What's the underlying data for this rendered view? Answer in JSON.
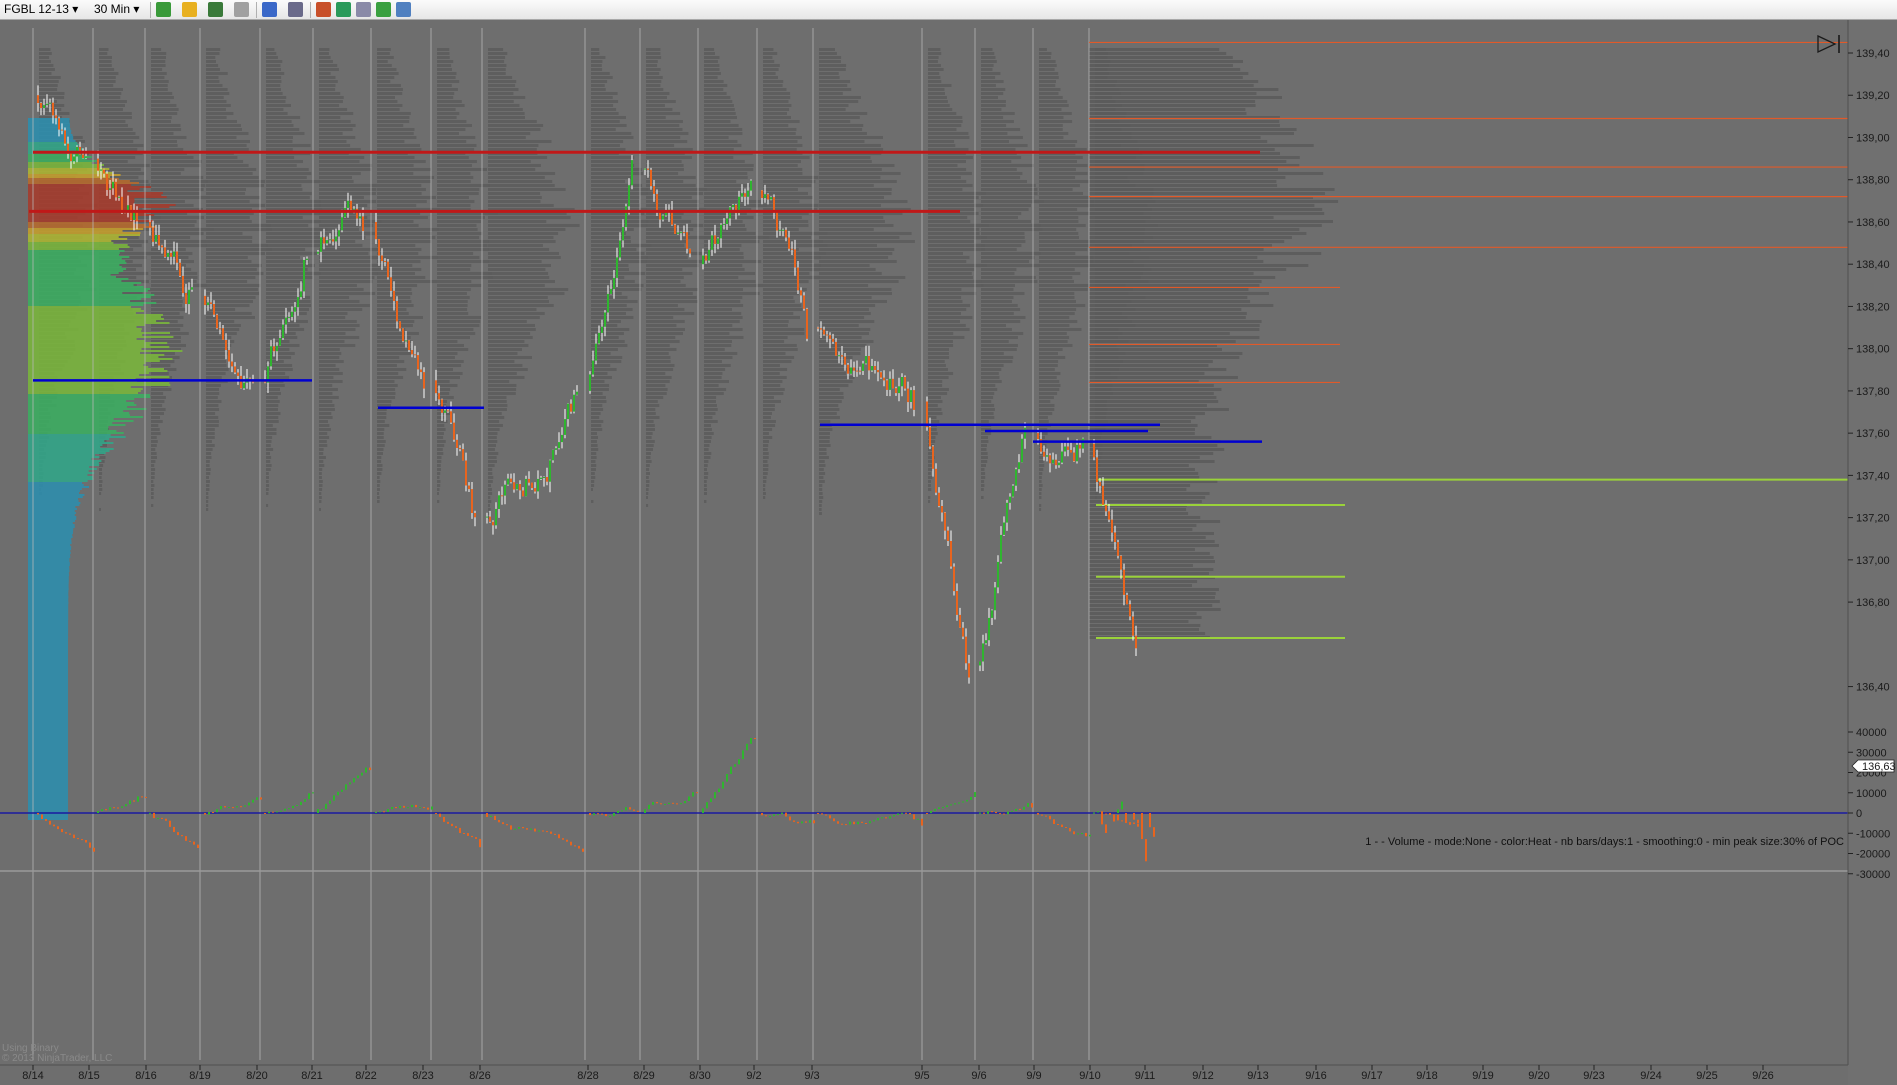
{
  "toolbar": {
    "instrument": "FGBL 12-13",
    "interval": "30 Min",
    "icons": [
      "bar-type-icon",
      "pencil-draw-icon",
      "properties-icon",
      "line-tool-icon",
      "crosshair-icon",
      "zoom-icon",
      "data-box-icon",
      "indicators-icon",
      "strategy-icon",
      "chart-trader-icon",
      "image-icon",
      "dollar-icon",
      "layout-icon"
    ]
  },
  "colors": {
    "background": "#6e6e6e",
    "up_candle": "#2fb52f",
    "down_candle": "#e8641e",
    "wick": "#ffffff",
    "value_area_low": "#0000d0",
    "value_area_high": "#c01818",
    "support_level": "#9ad23a",
    "resistance_level": "#e05a2a",
    "zero_line": "#1a1aa0"
  },
  "chart_data": [
    {
      "type": "candlestick",
      "title": "",
      "panel": "price",
      "ylim": [
        136.3,
        139.5
      ],
      "y_ticks": [
        "139,40",
        "139,20",
        "139,00",
        "138,80",
        "138,60",
        "138,40",
        "138,20",
        "138,00",
        "137,80",
        "137,60",
        "137,40",
        "137,20",
        "137,00",
        "136,80",
        "136,63",
        "136,40"
      ],
      "last_price": "136,63",
      "dates": [
        "8/14",
        "8/15",
        "8/16",
        "8/19",
        "8/20",
        "8/21",
        "8/22",
        "8/23",
        "8/26",
        "8/28",
        "8/29",
        "8/30",
        "9/2",
        "9/3",
        "9/5",
        "9/6",
        "9/9",
        "9/10",
        "9/11",
        "9/12",
        "9/13",
        "9/16",
        "9/17",
        "9/18",
        "9/19",
        "9/20",
        "9/23",
        "9/24",
        "9/25",
        "9/26"
      ],
      "session_closes": [
        138.9,
        138.6,
        138.25,
        137.85,
        138.45,
        138.6,
        137.85,
        137.2,
        137.8,
        138.85,
        138.4,
        138.75,
        138.1,
        137.75,
        136.5,
        137.6,
        137.55,
        136.63
      ],
      "value_area_lines": [
        {
          "price": 138.93,
          "color": "value_area_high"
        },
        {
          "price": 138.65,
          "color": "value_area_high"
        },
        {
          "price": 137.85,
          "color": "value_area_low"
        },
        {
          "price": 137.72,
          "color": "value_area_low"
        },
        {
          "price": 137.64,
          "color": "value_area_low"
        },
        {
          "price": 137.61,
          "color": "value_area_low"
        },
        {
          "price": 137.56,
          "color": "value_area_low"
        }
      ],
      "horizontal_levels": [
        {
          "price": 139.45,
          "color": "resistance_level"
        },
        {
          "price": 139.09,
          "color": "resistance_level"
        },
        {
          "price": 138.86,
          "color": "resistance_level"
        },
        {
          "price": 138.72,
          "color": "resistance_level"
        },
        {
          "price": 138.48,
          "color": "resistance_level"
        },
        {
          "price": 138.29,
          "color": "resistance_level"
        },
        {
          "price": 138.02,
          "color": "resistance_level"
        },
        {
          "price": 137.84,
          "color": "resistance_level"
        },
        {
          "price": 137.38,
          "color": "support_level"
        },
        {
          "price": 137.26,
          "color": "support_level"
        },
        {
          "price": 136.92,
          "color": "support_level"
        },
        {
          "price": 136.63,
          "color": "support_level"
        }
      ],
      "annotation": "1 -  - Volume - mode:None - color:Heat - nb bars/days:1 - smoothing:0 - min peak size:30% of POC"
    },
    {
      "type": "bar",
      "panel": "oscillator",
      "ylim": [
        -30000,
        40000
      ],
      "y_ticks": [
        "40000",
        "30000",
        "20000",
        "10000",
        "0",
        "-10000",
        "-20000",
        "-30000"
      ],
      "session_values": [
        -18000,
        9000,
        -17000,
        8000,
        10000,
        22000,
        3000,
        -16000,
        -18000,
        2000,
        11000,
        38000,
        -5000,
        -5000,
        10000,
        4000,
        -12000,
        -10000,
        -9000,
        -3000,
        6000,
        -7000,
        -6000,
        -23000,
        -13000
      ]
    }
  ],
  "footer": {
    "watermark_line1": "Using Binary",
    "watermark_line2": "© 2013 NinjaTrader, LLC"
  }
}
